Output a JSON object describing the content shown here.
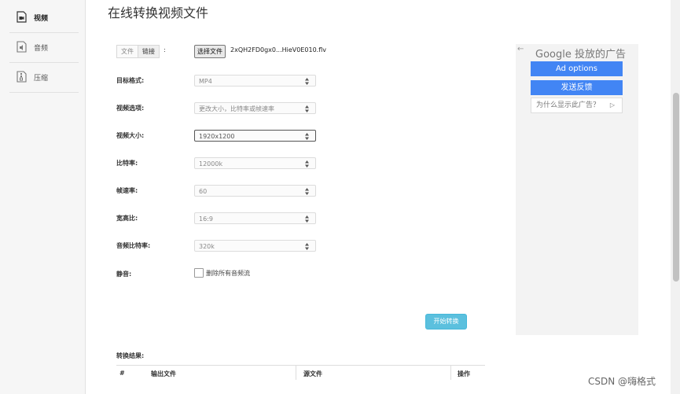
{
  "sidebar": {
    "items": [
      {
        "label": "视频",
        "icon": "video-file-icon",
        "active": true
      },
      {
        "label": "音频",
        "icon": "audio-file-icon",
        "active": false
      },
      {
        "label": "压缩",
        "icon": "compress-file-icon",
        "active": false
      }
    ]
  },
  "page": {
    "title": "在线转换视频文件"
  },
  "source": {
    "tabs": [
      "文件",
      "链接"
    ],
    "colon": ":",
    "file_button": "选择文件",
    "file_name": "2xQH2FD0gx0...HieV0E010.flv"
  },
  "form": {
    "fields": [
      {
        "label": "目标格式:",
        "value": "MP4"
      },
      {
        "label": "视频选项:",
        "value": "更改大小，比特率或帧速率"
      },
      {
        "label": "视频大小:",
        "value": "1920x1200"
      },
      {
        "label": "比特率:",
        "value": "12000k"
      },
      {
        "label": "帧速率:",
        "value": "60"
      },
      {
        "label": "宽高比:",
        "value": "16:9"
      },
      {
        "label": "音频比特率:",
        "value": "320k"
      }
    ],
    "mute_label": "静音:",
    "mute_checkbox_label": "删除所有音频流",
    "start_button": "开始转换"
  },
  "results": {
    "title": "转换结果:",
    "columns": [
      "#",
      "输出文件",
      "源文件",
      "操作"
    ]
  },
  "ad": {
    "header": "Google 投放的广告",
    "options_button": "Ad options",
    "feedback_button": "发送反馈",
    "why_text": "为什么显示此广告？",
    "brand_color": "#4285f4"
  },
  "watermark": "CSDN @嗨格式"
}
